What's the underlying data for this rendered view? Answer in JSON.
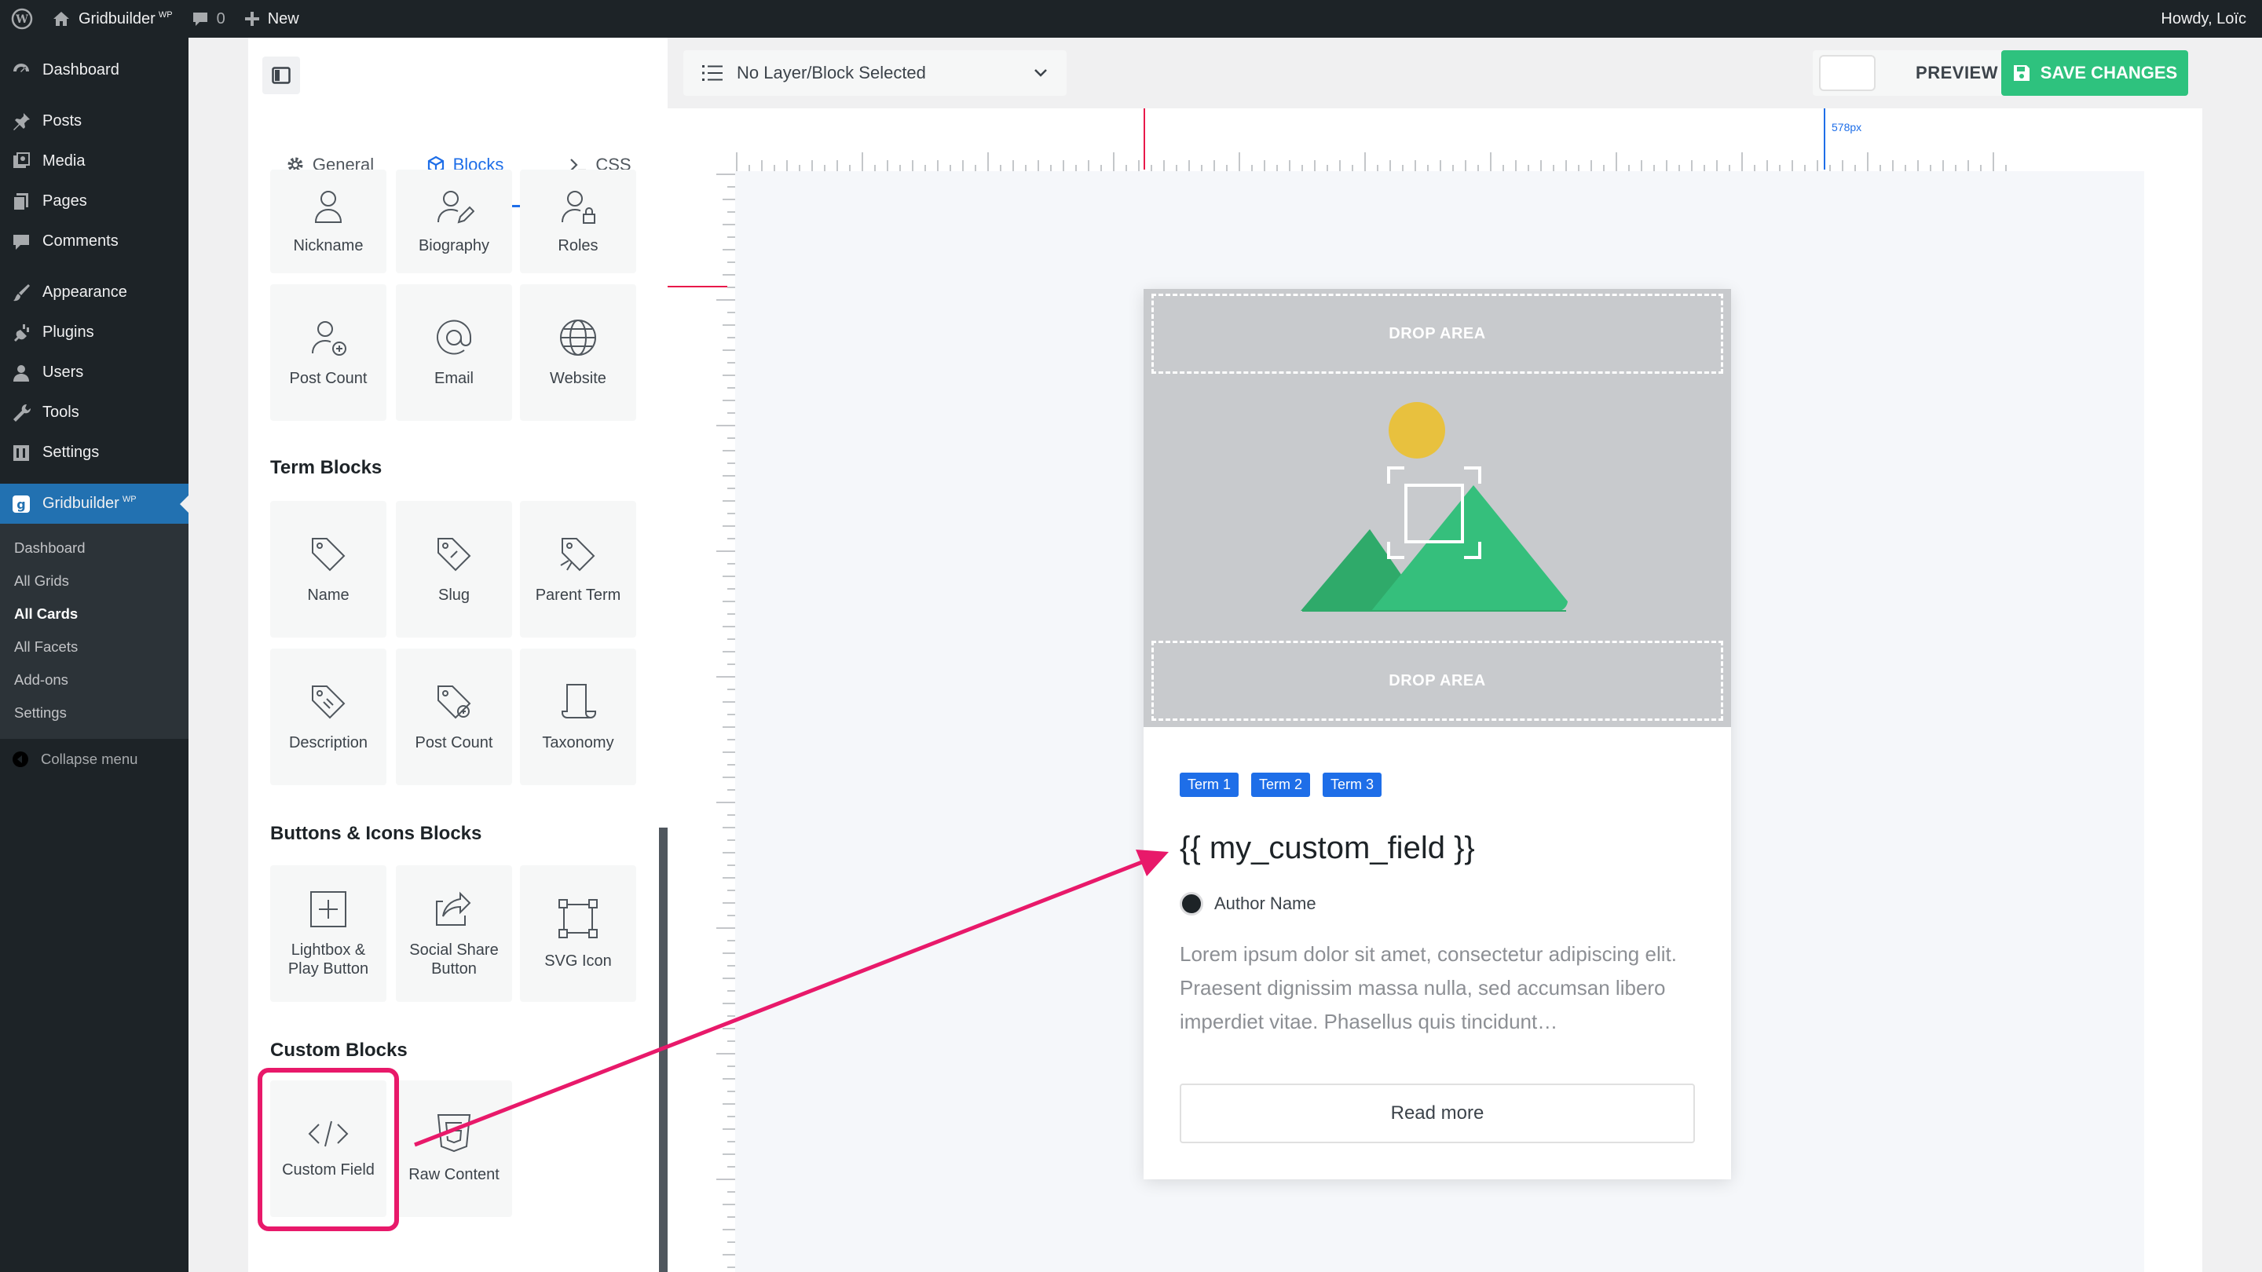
{
  "adminbar": {
    "site_name": "Gridbuilder",
    "site_sup": "WP",
    "comments_count": "0",
    "new_label": "New",
    "howdy": "Howdy, Loïc"
  },
  "menu": {
    "dashboard": "Dashboard",
    "posts": "Posts",
    "media": "Media",
    "pages": "Pages",
    "comments": "Comments",
    "appearance": "Appearance",
    "plugins": "Plugins",
    "users": "Users",
    "tools": "Tools",
    "settings": "Settings",
    "gridbuilder": "Gridbuilder",
    "gridbuilder_sup": "WP",
    "submenu": [
      "Dashboard",
      "All Grids",
      "All Cards",
      "All Facets",
      "Add-ons",
      "Settings"
    ],
    "collapse": "Collapse menu"
  },
  "panel": {
    "tabs": {
      "general": "General",
      "blocks": "Blocks",
      "css": "CSS"
    },
    "user_blocks": {
      "nickname": "Nickname",
      "biography": "Biography",
      "roles": "Roles",
      "post_count": "Post Count",
      "email": "Email",
      "website": "Website"
    },
    "term_title": "Term Blocks",
    "term_blocks": {
      "name": "Name",
      "slug": "Slug",
      "parent": "Parent Term",
      "description": "Description",
      "post_count": "Post Count",
      "taxonomy": "Taxonomy"
    },
    "buttons_title": "Buttons & Icons Blocks",
    "button_blocks": {
      "lightbox_1": "Lightbox &",
      "lightbox_2": "Play Button",
      "social_1": "Social Share",
      "social_2": "Button",
      "svg": "SVG Icon"
    },
    "custom_title": "Custom Blocks",
    "custom_blocks": {
      "custom_field": "Custom Field",
      "raw_content": "Raw Content"
    }
  },
  "topbar": {
    "layer_select": "No Layer/Block Selected",
    "preview": "PREVIEW",
    "save": "SAVE CHANGES"
  },
  "canvas": {
    "ruler_value": "578px",
    "card": {
      "drop_top": "DROP AREA",
      "drop_bottom": "DROP AREA",
      "terms": [
        "Term 1",
        "Term 2",
        "Term 3"
      ],
      "title": "{{ my_custom_field }}",
      "author": "Author Name",
      "excerpt": "Lorem ipsum dolor sit amet, consectetur adipiscing elit. Praesent dignissim massa nulla, sed accumsan libero imperdiet vitae. Phasellus quis tincidunt…",
      "read_more": "Read more"
    }
  },
  "colors": {
    "accent_blue": "#1e6ee8",
    "save_green": "#2ec27e",
    "highlight_pink": "#e8196a",
    "admin_dark": "#1d2327"
  }
}
